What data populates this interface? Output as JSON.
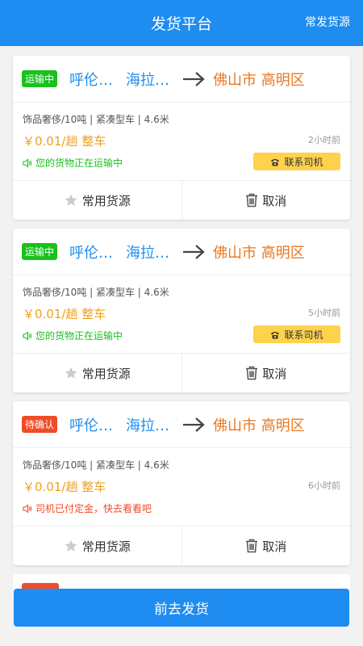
{
  "header": {
    "title": "发货平台",
    "right_link": "常发货源"
  },
  "colors": {
    "primary": "#1e8cf0",
    "destination": "#e87722",
    "price": "#f0a01e",
    "badge_transit": "#19c11e",
    "badge_pending": "#f04b28",
    "contact_bg": "#ffd24d"
  },
  "orders": [
    {
      "badge": "运输中",
      "badge_color": "#19c11e",
      "origin1": "呼伦…",
      "origin2": "海拉…",
      "destination": "佛山市 高明区",
      "spec": "饰品奢侈/10吨 | 紧凑型车 | 4.6米",
      "price": "￥0.01/趟 整车",
      "time": "2小时前",
      "status": "您的货物正在运输中",
      "status_color": "#19c11e",
      "contact_label": "联系司机",
      "fav_label": "常用货源",
      "cancel_label": "取消"
    },
    {
      "badge": "运输中",
      "badge_color": "#19c11e",
      "origin1": "呼伦…",
      "origin2": "海拉…",
      "destination": "佛山市 高明区",
      "spec": "饰品奢侈/10吨 | 紧凑型车 | 4.6米",
      "price": "￥0.01/趟 整车",
      "time": "5小时前",
      "status": "您的货物正在运输中",
      "status_color": "#19c11e",
      "contact_label": "联系司机",
      "fav_label": "常用货源",
      "cancel_label": "取消"
    },
    {
      "badge": "待确认",
      "badge_color": "#f04b28",
      "origin1": "呼伦…",
      "origin2": "海拉…",
      "destination": "佛山市 高明区",
      "spec": "饰品奢侈/10吨 | 紧凑型车 | 4.6米",
      "price": "￥0.01/趟 整车",
      "time": "6小时前",
      "status": "司机已付定金，快去看看吧",
      "status_color": "#f04b28",
      "contact_label": "",
      "fav_label": "常用货源",
      "cancel_label": "取消"
    }
  ],
  "icons": {
    "speaker": "speaker-icon",
    "phone": "phone-icon",
    "star": "star-icon",
    "trash": "trash-icon",
    "arrow": "arrow-right-icon"
  },
  "bottom_button": {
    "label": "前去发货"
  }
}
